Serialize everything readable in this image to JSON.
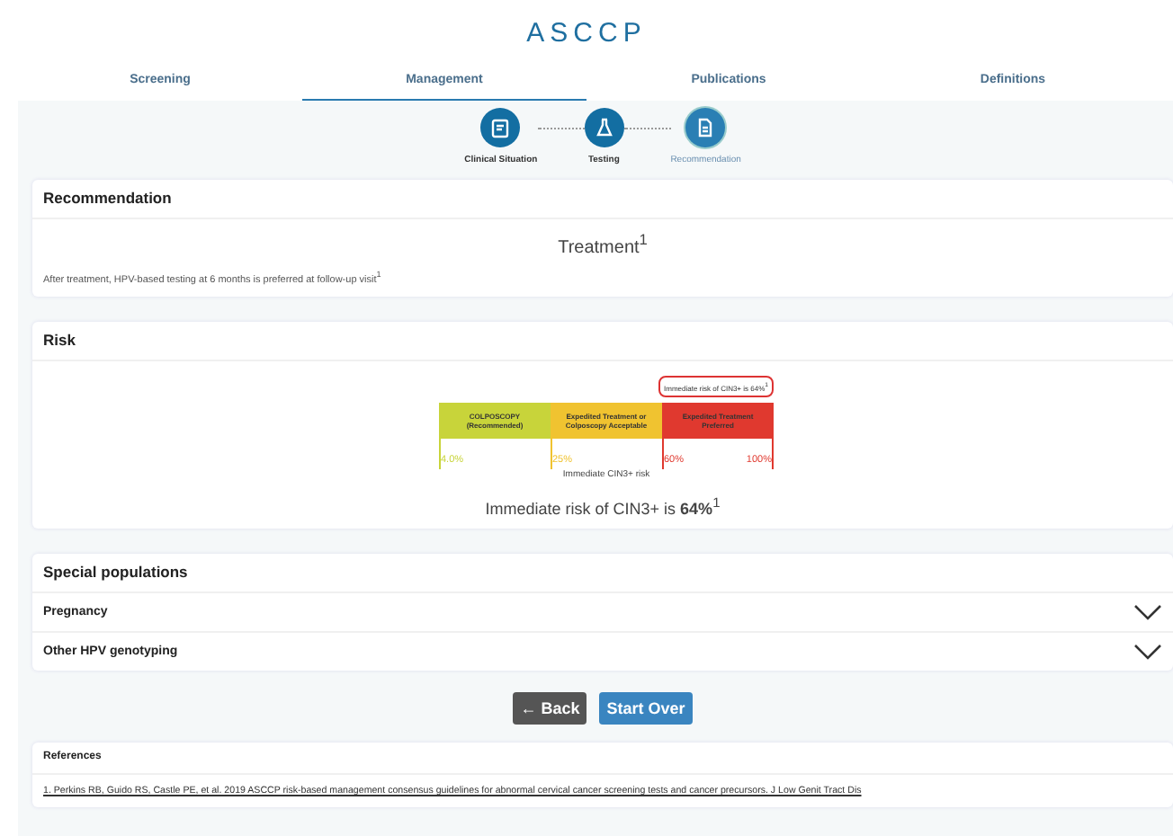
{
  "logo": "ASCCP",
  "tabs": [
    {
      "label": "Screening",
      "selected": false
    },
    {
      "label": "Management",
      "selected": true
    },
    {
      "label": "Publications",
      "selected": false
    },
    {
      "label": "Definitions",
      "selected": false
    }
  ],
  "steps": [
    {
      "label": "Clinical Situation",
      "kind": "clipboard",
      "done": true
    },
    {
      "label": "Testing",
      "kind": "flask",
      "done": true
    },
    {
      "label": "Recommendation",
      "kind": "document",
      "done": false
    }
  ],
  "recommendation": {
    "title": "Recommendation",
    "headline": "Treatment$^{1}$",
    "note": "After treatment, HPV-based testing at 6 months is preferred at follow-up visit$^{1}$"
  },
  "risk": {
    "title": "Risk",
    "callout": "Immediate risk of CIN3+ is 64%$^{1}$",
    "segments": [
      {
        "label": "COLPOSCOPY (Recommended)",
        "color": "#c8d43a"
      },
      {
        "label": "Expedited Treatment or Colposcopy Acceptable",
        "color": "#f0c330"
      },
      {
        "label": "Expedited Treatment Preferred",
        "color": "#e0392f"
      }
    ],
    "ticks": [
      {
        "label": "4.0%",
        "color": "#c8d43a"
      },
      {
        "label": "25%",
        "color": "#f0c330"
      },
      {
        "label": "60%",
        "color": "#e0392f"
      },
      {
        "label": "100%",
        "color": "#e0392f"
      }
    ],
    "axis_label": "Immediate CIN3+ risk",
    "summary": "Immediate risk of CIN3+ is **64%**$^{1}$"
  },
  "special": {
    "title": "Special populations",
    "items": [
      {
        "label": "Pregnancy",
        "expanded": false
      },
      {
        "label": "Other HPV genotyping",
        "expanded": false
      }
    ]
  },
  "buttons": {
    "back": "← Back",
    "start_over": "Start Over"
  },
  "references": {
    "title": "References",
    "items": [
      "1. Perkins RB, Guido RS, Castle PE, et al. 2019 ASCCP risk-based management consensus guidelines for abnormal cervical cancer screening tests and cancer precursors. J Low Genit Tract Dis"
    ]
  }
}
